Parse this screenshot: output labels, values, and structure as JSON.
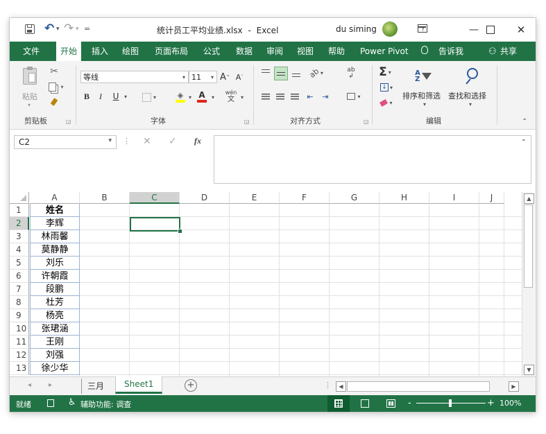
{
  "title": {
    "filename": "统计员工平均业绩.xlsx",
    "separator": "-",
    "app": "Excel",
    "user": "du siming",
    "undo_caret": "▾",
    "redo_caret": "▾",
    "qat_caret": "="
  },
  "tabs": [
    "文件",
    "开始",
    "插入",
    "绘图",
    "页面布局",
    "公式",
    "数据",
    "审阅",
    "视图",
    "帮助",
    "Power Pivot",
    "告诉我"
  ],
  "share_label": "共享",
  "ribbon": {
    "clipboard": {
      "paste": "粘贴",
      "group": "剪贴板"
    },
    "font": {
      "name": "等线",
      "size": "11",
      "grow": "A",
      "shrink": "A",
      "bold": "B",
      "italic": "I",
      "underline": "U",
      "phonetic": "wén",
      "phonetic_sub": "文",
      "group": "字体"
    },
    "alignment": {
      "group": "对齐方式"
    },
    "editing": {
      "sort_filter": "排序和筛选",
      "find_select": "查找和选择",
      "group": "编辑"
    }
  },
  "formula_bar": {
    "name_box": "C2",
    "fx": "fx",
    "content": ""
  },
  "columns": [
    "A",
    "B",
    "C",
    "D",
    "E",
    "F",
    "G",
    "H",
    "I",
    "J"
  ],
  "rows": [
    "1",
    "2",
    "3",
    "4",
    "5",
    "6",
    "7",
    "8",
    "9",
    "10",
    "11",
    "12",
    "13"
  ],
  "column_a": [
    "姓名",
    "李辉",
    "林雨馨",
    "莫静静",
    "刘乐",
    "许朝霞",
    "段鹏",
    "杜芳",
    "杨亮",
    "张珺涵",
    "王刚",
    "刘强",
    "徐少华"
  ],
  "sheets": [
    "三月",
    "Sheet1"
  ],
  "active_sheet": "Sheet1",
  "status": {
    "ready": "就绪",
    "accessibility": "辅助功能: 调查",
    "zoom_out": "-",
    "zoom_in": "+",
    "zoom": "100%"
  },
  "colors": {
    "accent": "#217346",
    "ribbon_bg": "#f3f3f3"
  }
}
